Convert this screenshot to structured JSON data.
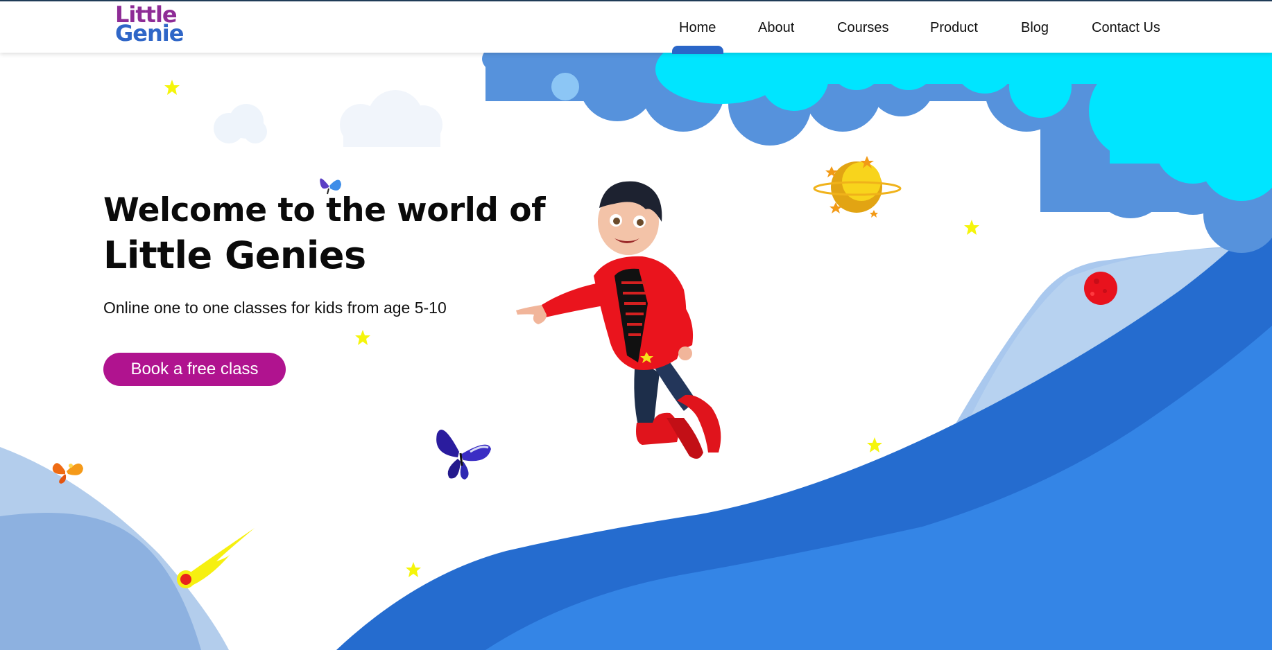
{
  "brand": {
    "logo_line1": "Little",
    "logo_line2": "Genie",
    "colors": {
      "purple": "#8e2c96",
      "blue": "#2f66c7",
      "accent": "#b0138f"
    }
  },
  "nav": {
    "items": [
      {
        "label": "Home",
        "active": true
      },
      {
        "label": "About"
      },
      {
        "label": "Courses"
      },
      {
        "label": "Product"
      },
      {
        "label": "Blog"
      },
      {
        "label": "Contact Us"
      }
    ]
  },
  "hero": {
    "title_line1": "Welcome to the world of",
    "title_line2": "Little Genies",
    "subtitle": "Online one to one classes for kids from age 5-10",
    "cta_label": "Book a free class"
  },
  "decorations": [
    "star-icon",
    "butterfly-icon",
    "planet-icon",
    "comet-icon",
    "cloud-icon",
    "boy-character-illustration"
  ]
}
